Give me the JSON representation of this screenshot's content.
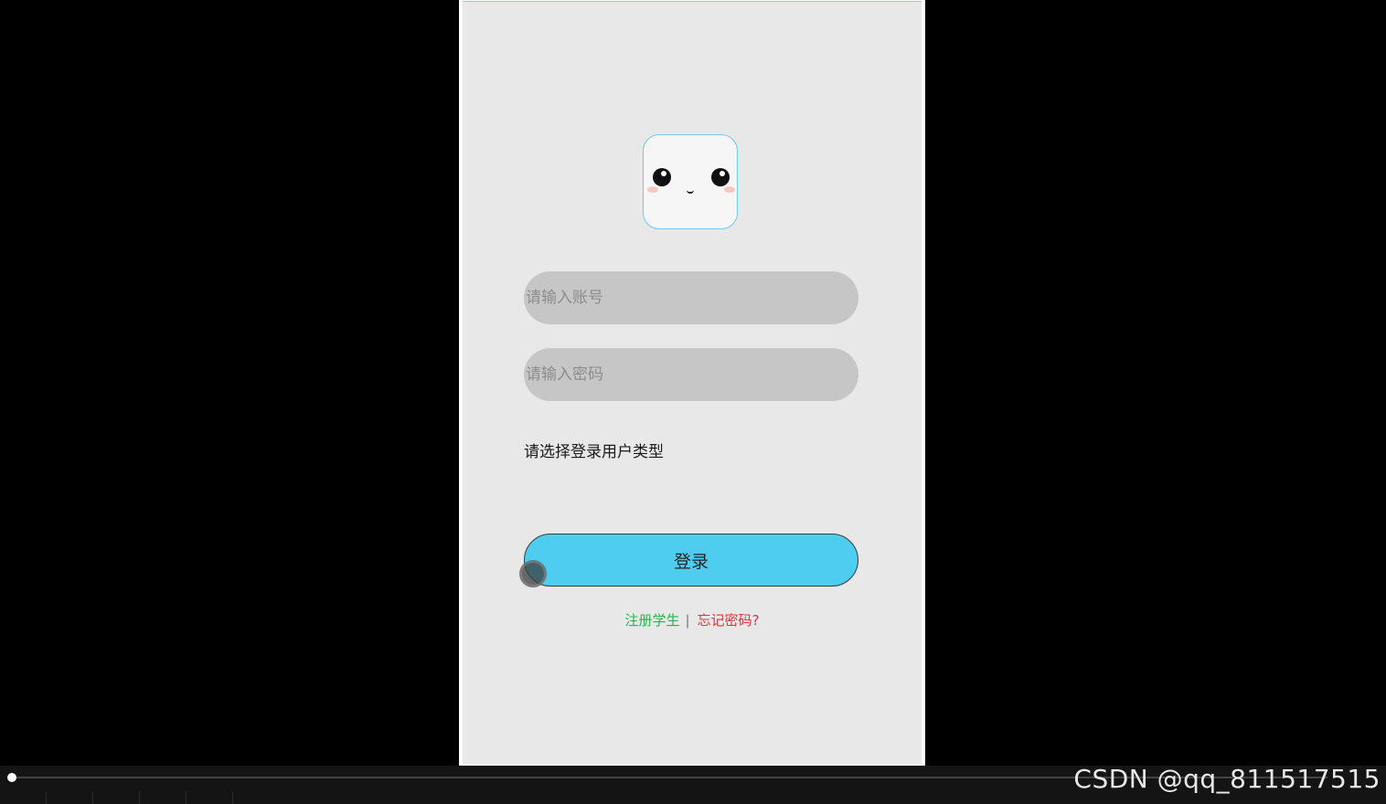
{
  "login": {
    "account_placeholder": "请输入账号",
    "password_placeholder": "请输入密码",
    "user_type_label": "请选择登录用户类型",
    "login_button": "登录",
    "register_link": "注册学生",
    "separator": "|",
    "forgot_link": "忘记密码?"
  },
  "colors": {
    "page_background": "#e8e8e8",
    "input_background": "#c6c6c6",
    "login_button": "#4ecdf1",
    "register_link": "#2bb24c",
    "forgot_link": "#e0353b",
    "avatar_border": "#6ccbea"
  },
  "icons": {
    "avatar": "cute-face-icon"
  },
  "player": {
    "progress": 0.0
  },
  "watermark": "CSDN @qq_811517515"
}
